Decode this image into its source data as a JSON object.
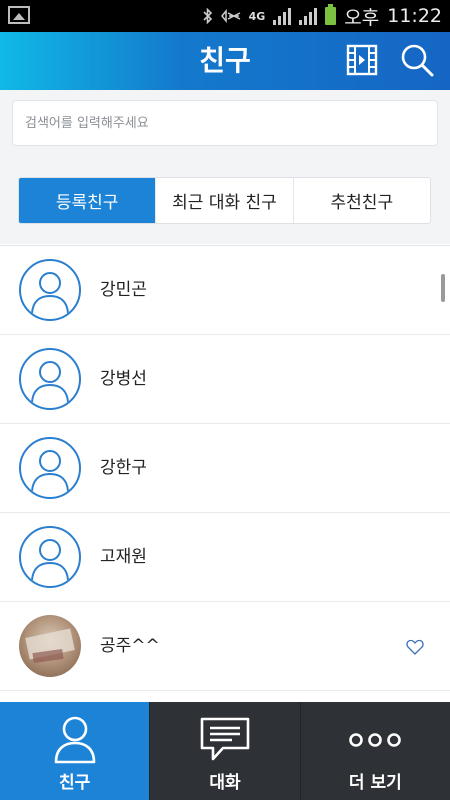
{
  "status_bar": {
    "time_prefix": "오후",
    "time": "11:22",
    "network": "4G",
    "icons": [
      "gallery-icon",
      "bluetooth-icon",
      "mute-icon",
      "network-4g-icon",
      "signal-icon",
      "battery-icon"
    ]
  },
  "header": {
    "title": "친구",
    "icons": [
      "video-icon",
      "search-icon"
    ],
    "gradient_start": "#10b9e7",
    "gradient_end": "#1566c4"
  },
  "search": {
    "placeholder": "검색어를 입력해주세요",
    "value": ""
  },
  "tabs": [
    {
      "label": "등록친구",
      "active": true
    },
    {
      "label": "최근 대화 친구",
      "active": false
    },
    {
      "label": "추천친구",
      "active": false
    }
  ],
  "friends": [
    {
      "name": "강민곤",
      "avatar": "default"
    },
    {
      "name": "강병선",
      "avatar": "default"
    },
    {
      "name": "강한구",
      "avatar": "default"
    },
    {
      "name": "고재원",
      "avatar": "default"
    },
    {
      "name": "공주^^",
      "avatar": "photo",
      "favorite_icon": "heart-outline-icon"
    }
  ],
  "bottom_nav": [
    {
      "label": "친구",
      "icon": "person-icon",
      "active": true
    },
    {
      "label": "대화",
      "icon": "chat-icon",
      "active": false
    },
    {
      "label": "더 보기",
      "icon": "more-icon",
      "active": false
    }
  ],
  "colors": {
    "accent": "#1d83d7",
    "nav_bg": "#2e3135",
    "avatar_border": "#2b7fcf"
  }
}
